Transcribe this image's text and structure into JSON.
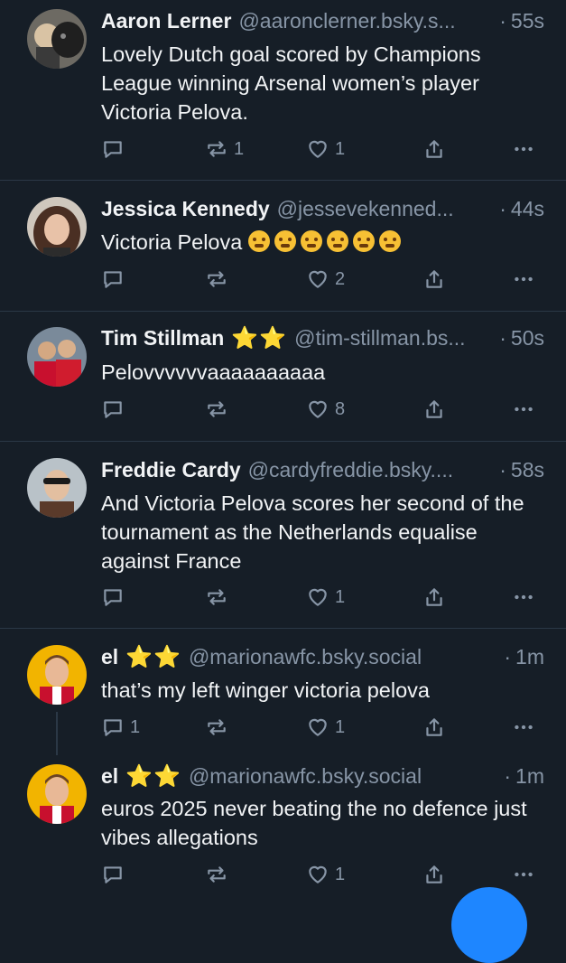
{
  "colors": {
    "background": "#161e27",
    "text": "#f1f3f5",
    "muted": "#8795a6",
    "divider": "#2b3846",
    "star": "#f5c518",
    "accent": "#1e86ff"
  },
  "posts": [
    {
      "name": "Aaron Lerner",
      "stars": "",
      "handle": "@aaronclerner.bsky.s...",
      "sep": "·",
      "time": "55s",
      "text": "Lovely Dutch goal scored by Champions League winning Arsenal women’s player Victoria Pelova.",
      "reply_count": "",
      "repost_count": "1",
      "like_count": "1"
    },
    {
      "name": "Jessica Kennedy",
      "stars": "",
      "handle": "@jessevekenned...",
      "sep": "·",
      "time": "44s",
      "text": "Victoria Pelova",
      "reply_count": "",
      "repost_count": "",
      "like_count": "2"
    },
    {
      "name": "Tim Stillman",
      "stars": "⭐⭐",
      "handle": "@tim-stillman.bs...",
      "sep": "·",
      "time": "50s",
      "text": "Pelovvvvvvaaaaaaaaaa",
      "reply_count": "",
      "repost_count": "",
      "like_count": "8"
    },
    {
      "name": "Freddie Cardy",
      "stars": "",
      "handle": "@cardyfreddie.bsky....",
      "sep": "·",
      "time": "58s",
      "text": "And Victoria Pelova scores her second of the tournament as the Netherlands equalise against France",
      "reply_count": "",
      "repost_count": "",
      "like_count": "1"
    },
    {
      "name": "el",
      "stars": "⭐⭐",
      "handle": "@marionawfc.bsky.social",
      "sep": "·",
      "time": "1m",
      "text": "that’s my left winger victoria pelova",
      "reply_count": "1",
      "repost_count": "",
      "like_count": "1"
    },
    {
      "name": "el",
      "stars": "⭐⭐",
      "handle": "@marionawfc.bsky.social",
      "sep": "·",
      "time": "1m",
      "text": "euros 2025 never beating the no defence just vibes allegations",
      "reply_count": "",
      "repost_count": "",
      "like_count": "1"
    }
  ],
  "icons": {
    "reply": "reply-icon",
    "repost": "repost-icon",
    "like": "heart-icon",
    "share": "share-icon",
    "more": "more-icon"
  }
}
